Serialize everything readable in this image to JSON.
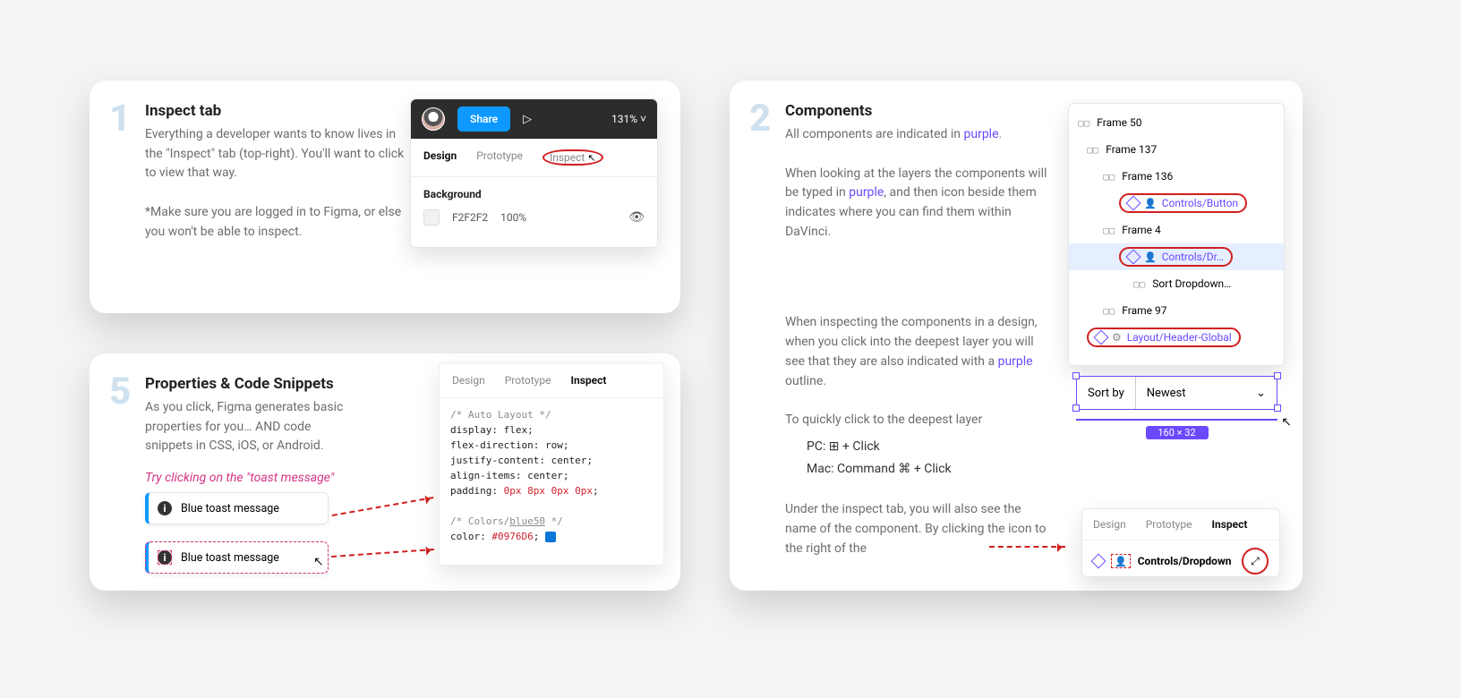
{
  "card1": {
    "num": "1",
    "title": "Inspect tab",
    "p1": "Everything a developer wants to know lives in the \"Inspect\" tab (top-right). You'll want to click to view that way.",
    "p2": "*Make sure you are logged in to Figma, or else you won't be able to inspect.",
    "share": "Share",
    "zoom": "131%",
    "tab_design": "Design",
    "tab_proto": "Prototype",
    "tab_inspect": "Inspect",
    "bg_label": "Background",
    "bg_hex": "F2F2F2",
    "bg_opacity": "100%"
  },
  "card5": {
    "num": "5",
    "title": "Properties & Code Snippets",
    "p1": "As you click, Figma generates basic properties for you… AND code snippets in CSS, iOS, or Android.",
    "hint": "Try clicking on the \"toast message\"",
    "toast": "Blue toast message",
    "tab_design": "Design",
    "tab_proto": "Prototype",
    "tab_inspect": "Inspect",
    "code_c1": "/* Auto Layout */",
    "code_l1": "display: flex;",
    "code_l2": "flex-direction: row;",
    "code_l3": "justify-content: center;",
    "code_l4": "align-items: center;",
    "code_l5a": "padding: ",
    "code_l5b": "0px 8px 0px 0px",
    "code_c2a": "/* Colors/",
    "code_c2b": "blue50",
    "code_c2c": " */",
    "code_l6a": "color: ",
    "code_l6b": "#0976D6",
    "code_l6c": ";"
  },
  "card2": {
    "num": "2",
    "title": "Components",
    "p1a": "All components are indicated in ",
    "purple": "purple",
    "p1b": ".",
    "p2a": "When looking at the layers the components will be typed in ",
    "p2b": ", and then icon beside them indicates where you can find them within DaVinci.",
    "p3a": "When inspecting the components in a design, when you click into the deepest layer you will see that they are also indicated with a ",
    "p3b": " outline.",
    "p4": "To quickly click to the deepest layer",
    "pc": "PC: ⊞ + Click",
    "mac": "Mac:  Command ⌘ + Click",
    "p5": "Under the inspect tab, you will also see the name of the component. By clicking the icon to the right of the",
    "tree": {
      "f50": "Frame 50",
      "f137": "Frame 137",
      "f136": "Frame 136",
      "btn": "Controls/Button",
      "f4": "Frame 4",
      "dr": "Controls/Dr…",
      "sort": "Sort Dropdown…",
      "f97": "Frame 97",
      "hdr": "Layout/Header-Global"
    },
    "sort_label": "Sort by",
    "sort_value": "Newest",
    "dims": "160 × 32",
    "insp_design": "Design",
    "insp_proto": "Prototype",
    "insp_inspect": "Inspect",
    "insp_name": "Controls/Dropdown"
  }
}
